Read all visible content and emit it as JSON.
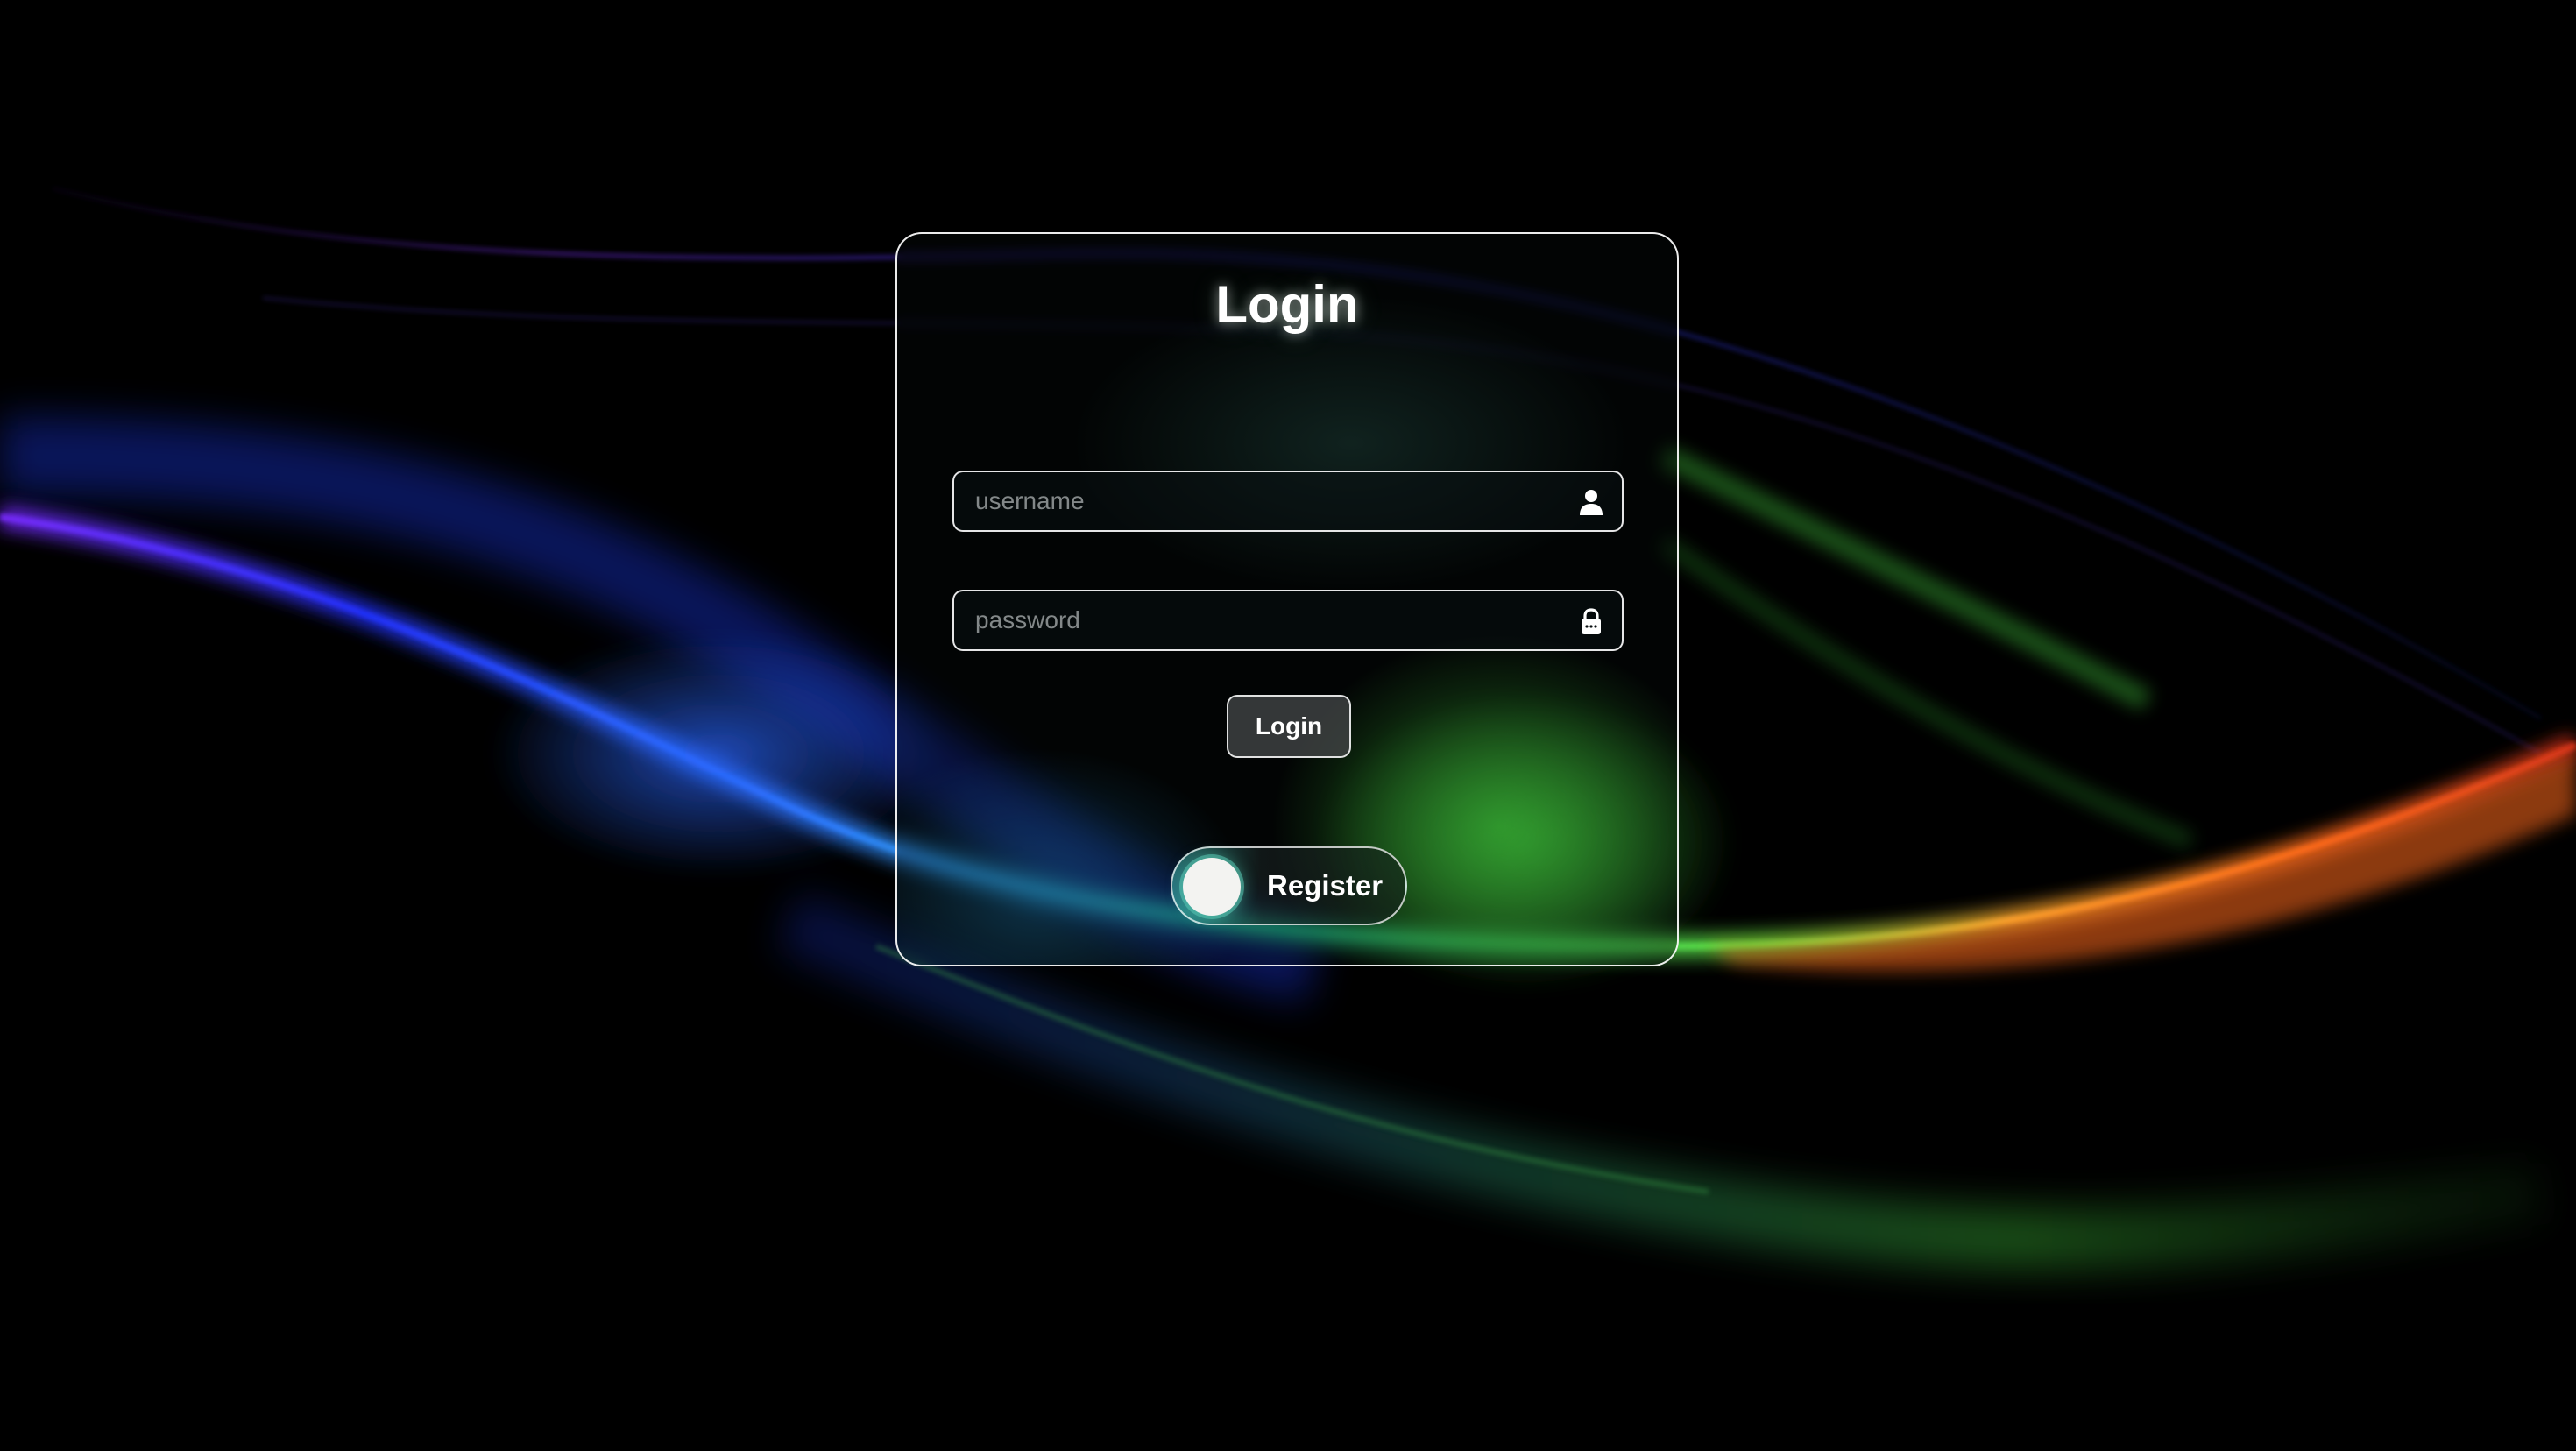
{
  "form": {
    "title": "Login",
    "username": {
      "placeholder": "username",
      "value": "",
      "icon": "user-icon"
    },
    "password": {
      "placeholder": "password",
      "value": "",
      "icon": "lock-icon"
    },
    "login_label": "Login",
    "register_toggle": {
      "label": "Register",
      "state": "off"
    }
  },
  "theme": {
    "background": "#000000",
    "card_border": "#ffffff",
    "accent_teal": "#40b4aa",
    "wave_blue": "#2a4cff",
    "wave_purple": "#8a2be2",
    "wave_green": "#3fbf3a",
    "wave_orange": "#ff7a1a"
  }
}
